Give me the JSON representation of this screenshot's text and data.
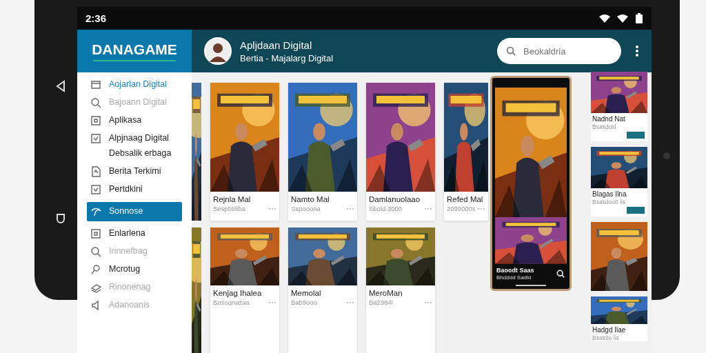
{
  "status_bar": {
    "time": "2:36"
  },
  "header": {
    "logo": "DANAGAME",
    "title": "Apljdaan Digital",
    "subtitle": "Bertia - Majalarg Digital",
    "search": {
      "placeholder": "Beokaldria"
    }
  },
  "sidebar": {
    "items": [
      {
        "label": "Aojarlan Digital",
        "current": true,
        "selected": false,
        "disabled": false
      },
      {
        "label": "Bajoann Digital",
        "current": false,
        "selected": false,
        "disabled": true
      },
      {
        "label": "Aplikasa",
        "current": false,
        "selected": false,
        "disabled": false
      },
      {
        "label": "Alpjnaag Digital",
        "note": "Debsalik erbaga",
        "current": false,
        "selected": false,
        "disabled": false
      },
      {
        "label": "Berita Terkimi",
        "current": false,
        "selected": false,
        "disabled": false
      },
      {
        "label": "Pertdkini",
        "current": false,
        "selected": false,
        "disabled": false
      },
      {
        "label": "Sonnose",
        "current": false,
        "selected": true,
        "disabled": false
      },
      {
        "label": "Enlarlena",
        "current": false,
        "selected": false,
        "disabled": false
      },
      {
        "label": "Irinnefbag",
        "current": false,
        "selected": false,
        "disabled": true
      },
      {
        "label": "Mcrotug",
        "current": false,
        "selected": false,
        "disabled": false
      },
      {
        "label": "Rinonenag",
        "current": false,
        "selected": false,
        "disabled": true
      },
      {
        "label": "Adanoanis",
        "current": false,
        "selected": false,
        "disabled": true
      }
    ]
  },
  "grid": {
    "rows": [
      [
        {
          "title": "Rejnla Mal",
          "subtitle": "Sespbbliba"
        },
        {
          "title": "Namto Mal",
          "subtitle": "Sspooona"
        },
        {
          "title": "Damlanuolaao",
          "subtitle": "Sbold.3000"
        },
        {
          "title": "Refed Mal",
          "subtitle": "2099000s"
        }
      ],
      [
        {
          "title": "Kenjag Ihalea",
          "subtitle": "Bosoqnazaa"
        },
        {
          "title": "Memolal",
          "subtitle": "Bab9ooo"
        },
        {
          "title": "MeroMan",
          "subtitle": "Ba2984l"
        }
      ]
    ]
  },
  "side_cards": [
    {
      "title": "Nadnd Nat",
      "subtitle": "Bsasdosl"
    },
    {
      "title": "Blagas Ilna",
      "subtitle": "Bsasdoo0 lis"
    }
  ],
  "phone": {
    "title": "Baoodt Saas",
    "subtitle": "Bhdddd Sadld"
  },
  "bottom_card": {
    "title": "Hadgd Ilae",
    "subtitle": "Bsas9o lis"
  }
}
